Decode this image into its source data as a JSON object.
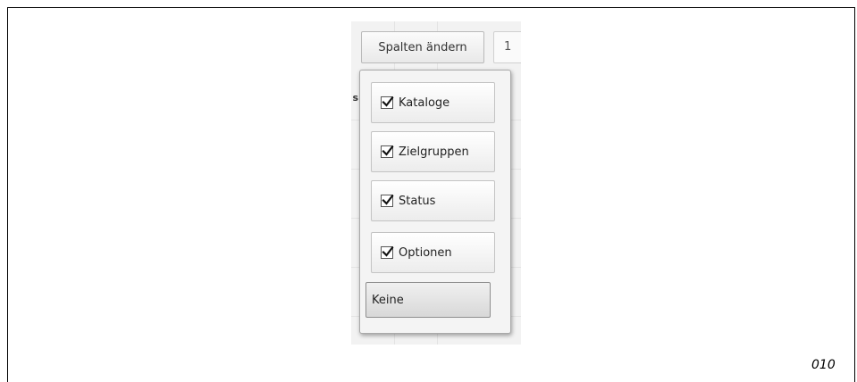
{
  "column_chooser": {
    "toggle_label": "Spalten ändern",
    "pager_fragment": "1",
    "column_header_fragment": "s",
    "options": [
      {
        "label": "Kataloge",
        "checked": true
      },
      {
        "label": "Zielgruppen",
        "checked": true
      },
      {
        "label": "Status",
        "checked": true
      },
      {
        "label": "Optionen",
        "checked": true
      }
    ],
    "none_label": "Keine"
  },
  "page_number": "010"
}
